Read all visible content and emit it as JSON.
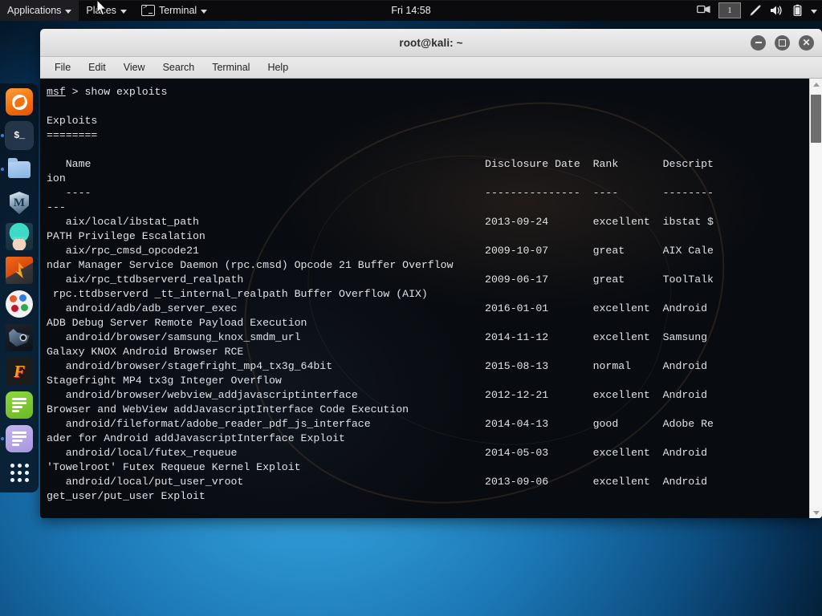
{
  "panel": {
    "menus": [
      {
        "label": "Applications",
        "icon": "none"
      },
      {
        "label": "Places",
        "icon": "none"
      },
      {
        "label": "Terminal",
        "icon": "terminal-icon"
      }
    ],
    "clock": "Fri 14:58",
    "workspace": "1",
    "tray": [
      {
        "name": "screen-share-icon",
        "glyph": "🖥"
      },
      {
        "name": "pen-icon",
        "glyph": "✒"
      },
      {
        "name": "volume-icon",
        "glyph": "🔊"
      },
      {
        "name": "battery-icon",
        "glyph": "🔋"
      }
    ]
  },
  "dock": {
    "items": [
      {
        "name": "firefox",
        "label": "Firefox ESR",
        "running": false
      },
      {
        "name": "terminal",
        "label": "Terminal",
        "running": true
      },
      {
        "name": "files",
        "label": "Files",
        "running": true
      },
      {
        "name": "metasploit",
        "label": "Metasploit Framework",
        "running": false
      },
      {
        "name": "armitage",
        "label": "Armitage",
        "running": false
      },
      {
        "name": "burpsuite-launcher",
        "label": "Burp Suite",
        "running": false
      },
      {
        "name": "burpsuite",
        "label": "Burp Suite",
        "running": false
      },
      {
        "name": "beef",
        "label": "BeEF",
        "running": false
      },
      {
        "name": "faraday",
        "label": "Faraday IDE",
        "running": false
      },
      {
        "name": "notes-green",
        "label": "Notes",
        "running": false
      },
      {
        "name": "notes-purple",
        "label": "Text Editor",
        "running": true
      },
      {
        "name": "show-applications",
        "label": "Show Applications",
        "running": false
      }
    ]
  },
  "window": {
    "title": "root@kali: ~",
    "controls": {
      "minimize": "−",
      "maximize": "□",
      "close": "✕"
    },
    "menubar": [
      "File",
      "Edit",
      "View",
      "Search",
      "Terminal",
      "Help"
    ]
  },
  "terminal": {
    "prompt_user": "msf",
    "prompt_symbol": ">",
    "command": "show exploits",
    "section_title": "Exploits",
    "section_rule": "========",
    "columns": [
      "Name",
      "Disclosure Date",
      "Rank",
      "Description"
    ],
    "lines": [
      {
        "t": "prompt",
        "text": "msf > show exploits"
      },
      {
        "t": "blank",
        "text": ""
      },
      {
        "t": "plain",
        "text": "Exploits"
      },
      {
        "t": "plain",
        "text": "========"
      },
      {
        "t": "blank",
        "text": ""
      },
      {
        "t": "plain",
        "text": "   Name                                                              Disclosure Date  Rank       Descript"
      },
      {
        "t": "plain",
        "text": "ion"
      },
      {
        "t": "plain",
        "text": "   ----                                                              ---------------  ----       --------"
      },
      {
        "t": "plain",
        "text": "---"
      },
      {
        "t": "plain",
        "text": "   aix/local/ibstat_path                                             2013-09-24       excellent  ibstat $"
      },
      {
        "t": "plain",
        "text": "PATH Privilege Escalation"
      },
      {
        "t": "plain",
        "text": "   aix/rpc_cmsd_opcode21                                             2009-10-07       great      AIX Cale"
      },
      {
        "t": "plain",
        "text": "ndar Manager Service Daemon (rpc.cmsd) Opcode 21 Buffer Overflow"
      },
      {
        "t": "plain",
        "text": "   aix/rpc_ttdbserverd_realpath                                      2009-06-17       great      ToolTalk"
      },
      {
        "t": "plain",
        "text": " rpc.ttdbserverd _tt_internal_realpath Buffer Overflow (AIX)"
      },
      {
        "t": "plain",
        "text": "   android/adb/adb_server_exec                                       2016-01-01       excellent  Android "
      },
      {
        "t": "plain",
        "text": "ADB Debug Server Remote Payload Execution"
      },
      {
        "t": "plain",
        "text": "   android/browser/samsung_knox_smdm_url                             2014-11-12       excellent  Samsung "
      },
      {
        "t": "plain",
        "text": "Galaxy KNOX Android Browser RCE"
      },
      {
        "t": "plain",
        "text": "   android/browser/stagefright_mp4_tx3g_64bit                        2015-08-13       normal     Android "
      },
      {
        "t": "plain",
        "text": "Stagefright MP4 tx3g Integer Overflow"
      },
      {
        "t": "plain",
        "text": "   android/browser/webview_addjavascriptinterface                    2012-12-21       excellent  Android "
      },
      {
        "t": "plain",
        "text": "Browser and WebView addJavascriptInterface Code Execution"
      },
      {
        "t": "plain",
        "text": "   android/fileformat/adobe_reader_pdf_js_interface                  2014-04-13       good       Adobe Re"
      },
      {
        "t": "plain",
        "text": "ader for Android addJavascriptInterface Exploit"
      },
      {
        "t": "plain",
        "text": "   android/local/futex_requeue                                       2014-05-03       excellent  Android "
      },
      {
        "t": "plain",
        "text": "'Towelroot' Futex Requeue Kernel Exploit"
      },
      {
        "t": "plain",
        "text": "   android/local/put_user_vroot                                      2013-09-06       excellent  Android "
      },
      {
        "t": "plain",
        "text": "get_user/put_user Exploit"
      }
    ],
    "exploits": [
      {
        "name": "aix/local/ibstat_path",
        "date": "2013-09-24",
        "rank": "excellent",
        "description": "ibstat $PATH Privilege Escalation"
      },
      {
        "name": "aix/rpc_cmsd_opcode21",
        "date": "2009-10-07",
        "rank": "great",
        "description": "AIX Calendar Manager Service Daemon (rpc.cmsd) Opcode 21 Buffer Overflow"
      },
      {
        "name": "aix/rpc_ttdbserverd_realpath",
        "date": "2009-06-17",
        "rank": "great",
        "description": "ToolTalk rpc.ttdbserverd _tt_internal_realpath Buffer Overflow (AIX)"
      },
      {
        "name": "android/adb/adb_server_exec",
        "date": "2016-01-01",
        "rank": "excellent",
        "description": "Android ADB Debug Server Remote Payload Execution"
      },
      {
        "name": "android/browser/samsung_knox_smdm_url",
        "date": "2014-11-12",
        "rank": "excellent",
        "description": "Samsung Galaxy KNOX Android Browser RCE"
      },
      {
        "name": "android/browser/stagefright_mp4_tx3g_64bit",
        "date": "2015-08-13",
        "rank": "normal",
        "description": "Android Stagefright MP4 tx3g Integer Overflow"
      },
      {
        "name": "android/browser/webview_addjavascriptinterface",
        "date": "2012-12-21",
        "rank": "excellent",
        "description": "Android Browser and WebView addJavascriptInterface Code Execution"
      },
      {
        "name": "android/fileformat/adobe_reader_pdf_js_interface",
        "date": "2014-04-13",
        "rank": "good",
        "description": "Adobe Reader for Android addJavascriptInterface Exploit"
      },
      {
        "name": "android/local/futex_requeue",
        "date": "2014-05-03",
        "rank": "excellent",
        "description": "Android 'Towelroot' Futex Requeue Kernel Exploit"
      },
      {
        "name": "android/local/put_user_vroot",
        "date": "2013-09-06",
        "rank": "excellent",
        "description": "Android get_user/put_user Exploit"
      }
    ]
  },
  "colors": {
    "panel_bg": "#0b0b0d",
    "terminal_bg": "#0a0d12",
    "terminal_fg": "#dfe3e6",
    "desktop_accent": "#1d84c4",
    "titlebar_bg": "#e6e6e6"
  }
}
